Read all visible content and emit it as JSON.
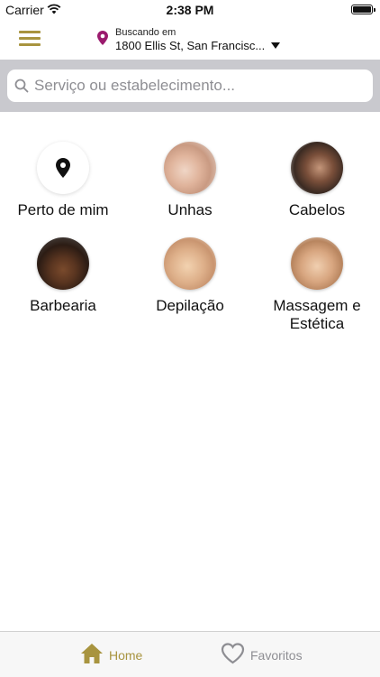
{
  "status_bar": {
    "carrier": "Carrier",
    "time": "2:38 PM"
  },
  "header": {
    "location_caption": "Buscando em",
    "location_address": "1800 Ellis St, San Francisc..."
  },
  "search": {
    "placeholder": "Serviço ou estabelecimento..."
  },
  "categories": [
    {
      "label": "Perto de mim",
      "icon": "location-pin-icon"
    },
    {
      "label": "Unhas",
      "icon": "nails-photo"
    },
    {
      "label": "Cabelos",
      "icon": "hair-photo"
    },
    {
      "label": "Barbearia",
      "icon": "barber-photo"
    },
    {
      "label": "Depilação",
      "icon": "waxing-photo"
    },
    {
      "label": "Massagem e Estética",
      "icon": "massage-photo"
    }
  ],
  "tab_bar": {
    "home_label": "Home",
    "favorites_label": "Favoritos"
  },
  "colors": {
    "accent": "#a8943f",
    "pin": "#9b1b6e",
    "search_bg": "#c9c9ce",
    "inactive": "#8e8e93"
  }
}
